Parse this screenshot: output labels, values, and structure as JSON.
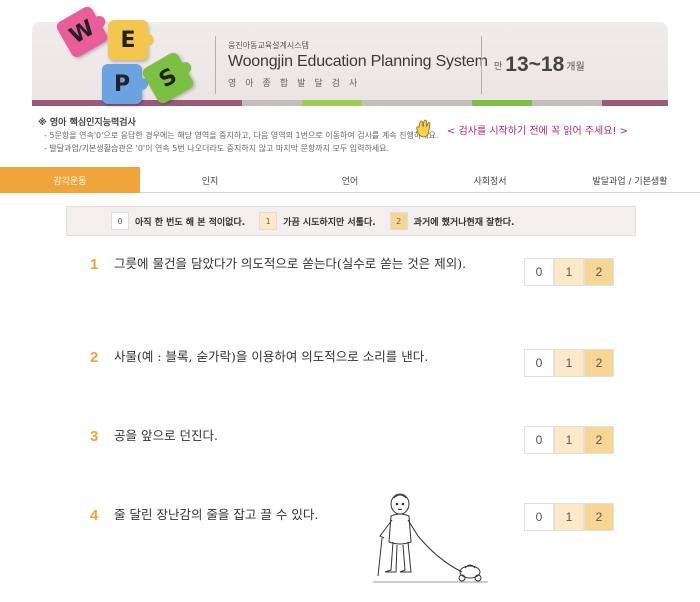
{
  "header": {
    "logo_letters": [
      "W",
      "E",
      "P",
      "S"
    ],
    "org": "웅진아동교육설계시스템",
    "title": "Woongjin Education Planning System",
    "subtitle": "영아종합발달검사",
    "age_prefix": "만",
    "age_range": "13~18",
    "age_suffix": "개월"
  },
  "notes": {
    "title": "※ 영아 핵심인지능력검사",
    "lines": [
      "- 5문항을 연속'0'으로 응답한 경우에는 해당 영역을 중지하고, 다음 영역의 1번으로 이동하여 검사를 계속 진행하세요.",
      "- 발달과업/기본생활습관은 '0'이 연속 5번 나오더라도 중지하지 않고 마지막 문항까지 모두 입력하세요."
    ],
    "notice": "< 검사를 시작하기 전에 꼭 읽어 주세요! >",
    "hand_icon": "pointing-hand-icon"
  },
  "tabs": [
    {
      "label": "감각운동",
      "active": true
    },
    {
      "label": "인지",
      "active": false
    },
    {
      "label": "언어",
      "active": false
    },
    {
      "label": "사회정서",
      "active": false
    },
    {
      "label": "발달과업 / 기본생활",
      "active": false
    }
  ],
  "legend": [
    {
      "value": "0",
      "text": "아직 한 번도 해 본 적이없다."
    },
    {
      "value": "1",
      "text": "가끔 시도하지만 서툴다."
    },
    {
      "value": "2",
      "text": "과거에 했거나현재 잘한다."
    }
  ],
  "questions": [
    {
      "num": "1",
      "text": "그릇에 물건을 담았다가 의도적으로 쏟는다(실수로 쏟는 것은 제외).",
      "options": [
        "0",
        "1",
        "2"
      ]
    },
    {
      "num": "2",
      "text": "사물(예 : 블록, 숟가락)을 이용하여 의도적으로 소리를 낸다.",
      "options": [
        "0",
        "1",
        "2"
      ]
    },
    {
      "num": "3",
      "text": "공을 앞으로 던진다.",
      "options": [
        "0",
        "1",
        "2"
      ]
    },
    {
      "num": "4",
      "text": "줄 달린 장난감의 줄을 잡고 끌 수 있다.",
      "options": [
        "0",
        "1",
        "2"
      ]
    }
  ],
  "colors": {
    "accent": "#f0a53a",
    "notice": "#b0287a",
    "stripe": [
      "#9c5a7b",
      "#c4bdbd",
      "#9ccf4d",
      "#c4bdbd",
      "#7bc043",
      "#c4bdbd",
      "#9c5a7b"
    ]
  },
  "illustration": "toddler-pulling-toy-illustration"
}
